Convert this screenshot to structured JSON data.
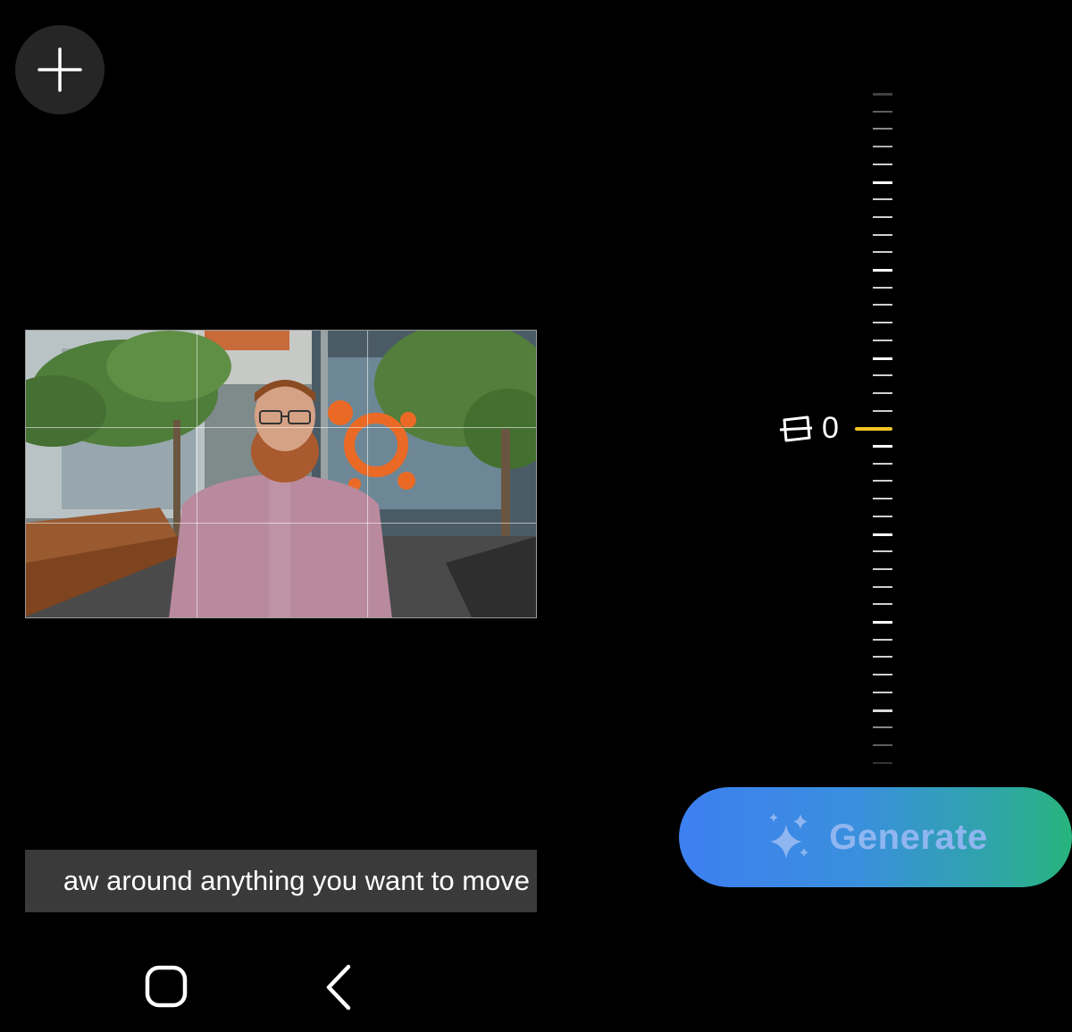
{
  "toolbar": {
    "add_icon": "plus-icon"
  },
  "editor": {
    "photo_alt": "Bearded man in pink shirt standing in front of a storefront with orange logo",
    "angle_value": "0",
    "angle_icon": "rotate-tilt-icon",
    "hint_text": "aw around anything you want to move",
    "active_tick_color": "#f5c425"
  },
  "actions": {
    "generate_label": "Generate",
    "generate_icon": "sparkle-icon"
  },
  "nav": {
    "home_icon": "home-square-icon",
    "back_icon": "chevron-left-icon"
  }
}
